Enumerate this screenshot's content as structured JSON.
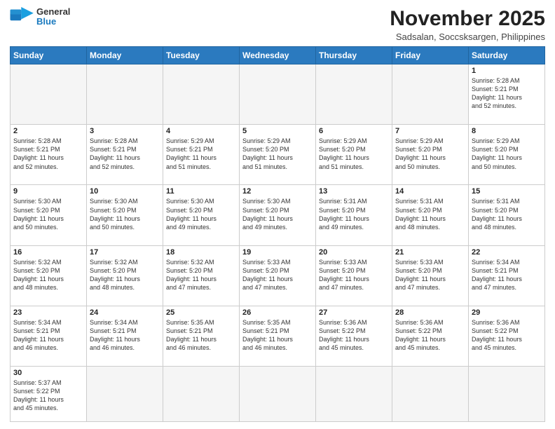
{
  "logo": {
    "general": "General",
    "blue": "Blue"
  },
  "title": "November 2025",
  "subtitle": "Sadsalan, Soccsksargen, Philippines",
  "weekdays": [
    "Sunday",
    "Monday",
    "Tuesday",
    "Wednesday",
    "Thursday",
    "Friday",
    "Saturday"
  ],
  "days": [
    {
      "num": "",
      "empty": true,
      "info": ""
    },
    {
      "num": "",
      "empty": true,
      "info": ""
    },
    {
      "num": "",
      "empty": true,
      "info": ""
    },
    {
      "num": "",
      "empty": true,
      "info": ""
    },
    {
      "num": "",
      "empty": true,
      "info": ""
    },
    {
      "num": "",
      "empty": true,
      "info": ""
    },
    {
      "num": "1",
      "empty": false,
      "info": "Sunrise: 5:28 AM\nSunset: 5:21 PM\nDaylight: 11 hours\nand 52 minutes."
    },
    {
      "num": "2",
      "empty": false,
      "info": "Sunrise: 5:28 AM\nSunset: 5:21 PM\nDaylight: 11 hours\nand 52 minutes."
    },
    {
      "num": "3",
      "empty": false,
      "info": "Sunrise: 5:28 AM\nSunset: 5:21 PM\nDaylight: 11 hours\nand 52 minutes."
    },
    {
      "num": "4",
      "empty": false,
      "info": "Sunrise: 5:29 AM\nSunset: 5:21 PM\nDaylight: 11 hours\nand 51 minutes."
    },
    {
      "num": "5",
      "empty": false,
      "info": "Sunrise: 5:29 AM\nSunset: 5:20 PM\nDaylight: 11 hours\nand 51 minutes."
    },
    {
      "num": "6",
      "empty": false,
      "info": "Sunrise: 5:29 AM\nSunset: 5:20 PM\nDaylight: 11 hours\nand 51 minutes."
    },
    {
      "num": "7",
      "empty": false,
      "info": "Sunrise: 5:29 AM\nSunset: 5:20 PM\nDaylight: 11 hours\nand 50 minutes."
    },
    {
      "num": "8",
      "empty": false,
      "info": "Sunrise: 5:29 AM\nSunset: 5:20 PM\nDaylight: 11 hours\nand 50 minutes."
    },
    {
      "num": "9",
      "empty": false,
      "info": "Sunrise: 5:30 AM\nSunset: 5:20 PM\nDaylight: 11 hours\nand 50 minutes."
    },
    {
      "num": "10",
      "empty": false,
      "info": "Sunrise: 5:30 AM\nSunset: 5:20 PM\nDaylight: 11 hours\nand 50 minutes."
    },
    {
      "num": "11",
      "empty": false,
      "info": "Sunrise: 5:30 AM\nSunset: 5:20 PM\nDaylight: 11 hours\nand 49 minutes."
    },
    {
      "num": "12",
      "empty": false,
      "info": "Sunrise: 5:30 AM\nSunset: 5:20 PM\nDaylight: 11 hours\nand 49 minutes."
    },
    {
      "num": "13",
      "empty": false,
      "info": "Sunrise: 5:31 AM\nSunset: 5:20 PM\nDaylight: 11 hours\nand 49 minutes."
    },
    {
      "num": "14",
      "empty": false,
      "info": "Sunrise: 5:31 AM\nSunset: 5:20 PM\nDaylight: 11 hours\nand 48 minutes."
    },
    {
      "num": "15",
      "empty": false,
      "info": "Sunrise: 5:31 AM\nSunset: 5:20 PM\nDaylight: 11 hours\nand 48 minutes."
    },
    {
      "num": "16",
      "empty": false,
      "info": "Sunrise: 5:32 AM\nSunset: 5:20 PM\nDaylight: 11 hours\nand 48 minutes."
    },
    {
      "num": "17",
      "empty": false,
      "info": "Sunrise: 5:32 AM\nSunset: 5:20 PM\nDaylight: 11 hours\nand 48 minutes."
    },
    {
      "num": "18",
      "empty": false,
      "info": "Sunrise: 5:32 AM\nSunset: 5:20 PM\nDaylight: 11 hours\nand 47 minutes."
    },
    {
      "num": "19",
      "empty": false,
      "info": "Sunrise: 5:33 AM\nSunset: 5:20 PM\nDaylight: 11 hours\nand 47 minutes."
    },
    {
      "num": "20",
      "empty": false,
      "info": "Sunrise: 5:33 AM\nSunset: 5:20 PM\nDaylight: 11 hours\nand 47 minutes."
    },
    {
      "num": "21",
      "empty": false,
      "info": "Sunrise: 5:33 AM\nSunset: 5:20 PM\nDaylight: 11 hours\nand 47 minutes."
    },
    {
      "num": "22",
      "empty": false,
      "info": "Sunrise: 5:34 AM\nSunset: 5:21 PM\nDaylight: 11 hours\nand 47 minutes."
    },
    {
      "num": "23",
      "empty": false,
      "info": "Sunrise: 5:34 AM\nSunset: 5:21 PM\nDaylight: 11 hours\nand 46 minutes."
    },
    {
      "num": "24",
      "empty": false,
      "info": "Sunrise: 5:34 AM\nSunset: 5:21 PM\nDaylight: 11 hours\nand 46 minutes."
    },
    {
      "num": "25",
      "empty": false,
      "info": "Sunrise: 5:35 AM\nSunset: 5:21 PM\nDaylight: 11 hours\nand 46 minutes."
    },
    {
      "num": "26",
      "empty": false,
      "info": "Sunrise: 5:35 AM\nSunset: 5:21 PM\nDaylight: 11 hours\nand 46 minutes."
    },
    {
      "num": "27",
      "empty": false,
      "info": "Sunrise: 5:36 AM\nSunset: 5:22 PM\nDaylight: 11 hours\nand 45 minutes."
    },
    {
      "num": "28",
      "empty": false,
      "info": "Sunrise: 5:36 AM\nSunset: 5:22 PM\nDaylight: 11 hours\nand 45 minutes."
    },
    {
      "num": "29",
      "empty": false,
      "info": "Sunrise: 5:36 AM\nSunset: 5:22 PM\nDaylight: 11 hours\nand 45 minutes."
    },
    {
      "num": "30",
      "empty": false,
      "info": "Sunrise: 5:37 AM\nSunset: 5:22 PM\nDaylight: 11 hours\nand 45 minutes."
    },
    {
      "num": "",
      "empty": true,
      "info": ""
    },
    {
      "num": "",
      "empty": true,
      "info": ""
    },
    {
      "num": "",
      "empty": true,
      "info": ""
    },
    {
      "num": "",
      "empty": true,
      "info": ""
    },
    {
      "num": "",
      "empty": true,
      "info": ""
    },
    {
      "num": "",
      "empty": true,
      "info": ""
    }
  ]
}
